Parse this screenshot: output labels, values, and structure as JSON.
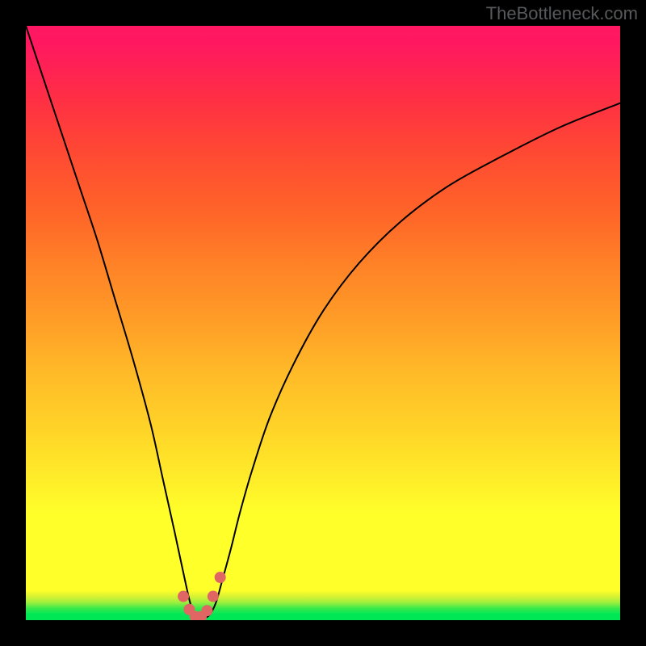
{
  "watermark": "TheBottleneck.com",
  "colors": {
    "frame_bg": "#000000",
    "watermark": "#58595b",
    "curve": "#000000",
    "dot": "#e06664",
    "gradient_stops": [
      "#00e756",
      "#3be94b",
      "#9fef3d",
      "#d8f232",
      "#ffff2a",
      "#ffec29",
      "#ffd428",
      "#ffb928",
      "#ff9e27",
      "#ff8127",
      "#ff6628",
      "#ff4b32",
      "#ff2e45",
      "#ff1860",
      "#ff1763"
    ]
  },
  "chart_data": {
    "type": "line",
    "title": "",
    "xlabel": "",
    "ylabel": "",
    "xlim": [
      0,
      100
    ],
    "ylim": [
      0,
      100
    ],
    "legend": false,
    "grid": false,
    "series": [
      {
        "name": "bottleneck-curve",
        "x": [
          0,
          3,
          6,
          9,
          12,
          15,
          18,
          21,
          23,
          25,
          26.5,
          27.5,
          28.2,
          29.0,
          30.0,
          31.0,
          32.0,
          33.0,
          34.5,
          36,
          38,
          41,
          45,
          50,
          56,
          63,
          71,
          80,
          90,
          100
        ],
        "y": [
          100,
          91,
          82,
          73,
          64,
          54,
          44,
          33,
          24,
          15,
          8,
          3.5,
          1.2,
          0.3,
          0.3,
          1.0,
          3.0,
          6.5,
          12,
          18,
          25,
          34,
          43,
          52,
          60,
          67,
          73,
          78,
          83,
          87
        ]
      }
    ],
    "markers": [
      {
        "x": 26.5,
        "y": 4.0
      },
      {
        "x": 27.5,
        "y": 1.8
      },
      {
        "x": 28.5,
        "y": 0.6
      },
      {
        "x": 29.5,
        "y": 0.6
      },
      {
        "x": 30.5,
        "y": 1.6
      },
      {
        "x": 31.5,
        "y": 4.0
      },
      {
        "x": 32.7,
        "y": 7.2
      }
    ],
    "annotations": []
  }
}
